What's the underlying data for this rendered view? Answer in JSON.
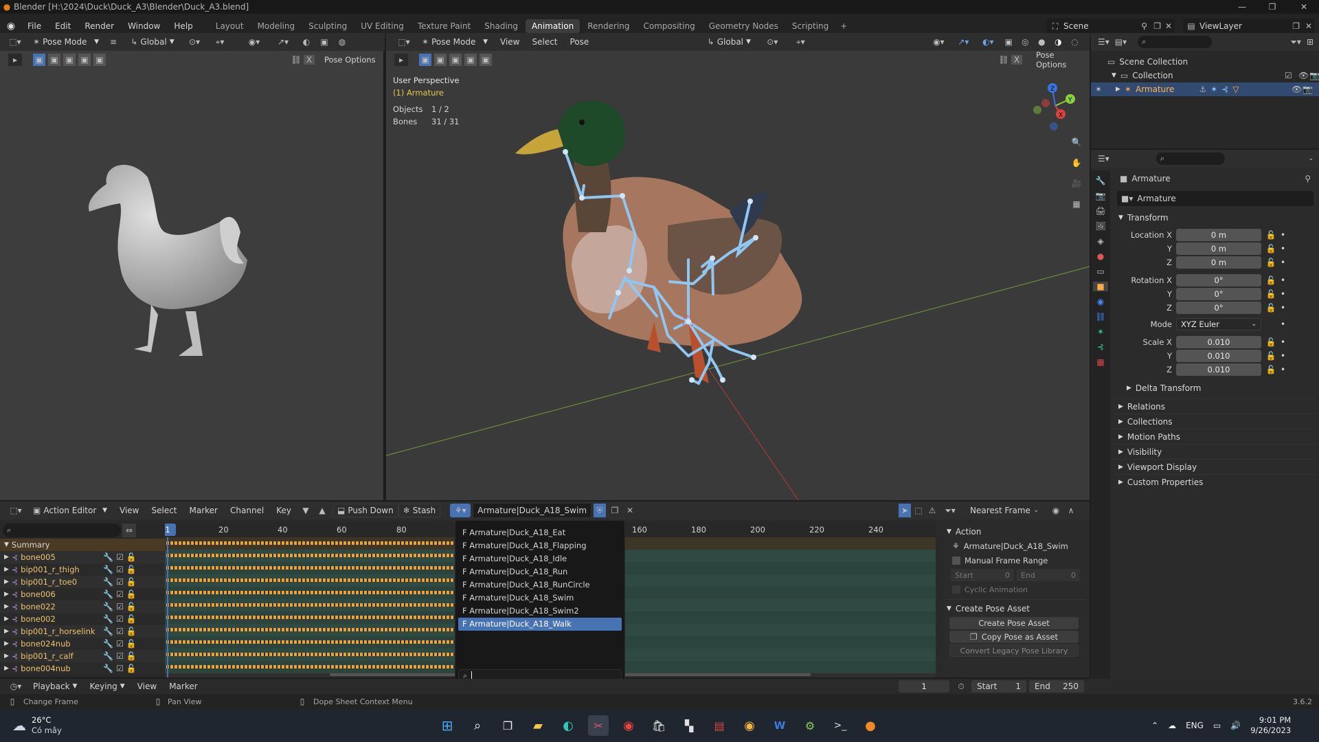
{
  "window": {
    "title": "Blender [H:\\2024\\Duck\\Duck_A3\\Blender\\Duck_A3.blend]"
  },
  "menu": [
    "File",
    "Edit",
    "Render",
    "Window",
    "Help"
  ],
  "workspaces": [
    "Layout",
    "Modeling",
    "Sculpting",
    "UV Editing",
    "Texture Paint",
    "Shading",
    "Animation",
    "Rendering",
    "Compositing",
    "Geometry Nodes",
    "Scripting",
    "+"
  ],
  "active_workspace": "Animation",
  "scene": {
    "name": "Scene",
    "view_layer": "ViewLayer"
  },
  "left_view": {
    "mode": "Pose Mode",
    "orientation": "Global",
    "options": "Pose Options"
  },
  "main_view": {
    "mode": "Pose Mode",
    "menu": [
      "View",
      "Select",
      "Pose"
    ],
    "orientation": "Global",
    "options": "Pose Options",
    "overlay_title": "User Perspective",
    "overlay_object": "(1) Armature",
    "objects_label": "Objects",
    "objects_value": "1 / 2",
    "bones_label": "Bones",
    "bones_value": "31 / 31"
  },
  "outliner": {
    "scene_collection": "Scene Collection",
    "collection": "Collection",
    "armature": "Armature"
  },
  "properties": {
    "object_name": "Armature",
    "datablock": "Armature",
    "transform_label": "Transform",
    "location": {
      "label": "Location X",
      "x": "0 m",
      "y": "0 m",
      "z": "0 m"
    },
    "rotation": {
      "label": "Rotation X",
      "x": "0°",
      "y": "0°",
      "z": "0°"
    },
    "mode_label": "Mode",
    "mode_value": "XYZ Euler",
    "scale": {
      "label": "Scale X",
      "x": "0.010",
      "y": "0.010",
      "z": "0.010"
    },
    "y_label": "Y",
    "z_label": "Z",
    "delta": "Delta Transform",
    "panels": [
      "Relations",
      "Collections",
      "Motion Paths",
      "Visibility",
      "Viewport Display",
      "Custom Properties"
    ]
  },
  "action_editor": {
    "editor": "Action Editor",
    "menu": [
      "View",
      "Select",
      "Marker",
      "Channel",
      "Key"
    ],
    "push_down": "Push Down",
    "stash": "Stash",
    "action": "Armature|Duck_A18_Swim",
    "snap": "Nearest Frame",
    "current_frame": "1",
    "ticks": [
      "20",
      "40",
      "60",
      "80",
      "160",
      "180",
      "200",
      "220",
      "240"
    ],
    "summary": "Summary",
    "channels": [
      "bone005",
      "bip001_r_thigh",
      "bip001_r_toe0",
      "bone006",
      "bone022",
      "bone002",
      "bip001_r_horselink",
      "bone024nub",
      "bip001_r_calf",
      "bone004nub"
    ]
  },
  "action_dropdown": {
    "items": [
      "F Armature|Duck_A18_Eat",
      "F Armature|Duck_A18_Flapping",
      "F Armature|Duck_A18_Idle",
      "F Armature|Duck_A18_Run",
      "F Armature|Duck_A18_RunCircle",
      "F Armature|Duck_A18_Swim",
      "F Armature|Duck_A18_Swim2",
      "F Armature|Duck_A18_Walk"
    ],
    "selected": 7
  },
  "action_panel": {
    "title": "Action",
    "name": "Armature|Duck_A18_Swim",
    "manual_range": "Manual Frame Range",
    "start_label": "Start",
    "start_value": "0",
    "end_label": "End",
    "end_value": "0",
    "cyclic": "Cyclic Animation",
    "pose_title": "Create Pose Asset",
    "create_btn": "Create Pose Asset",
    "copy_btn": "Copy Pose as Asset",
    "convert_btn": "Convert Legacy Pose Library"
  },
  "timeline": {
    "menu": [
      "Playback",
      "Keying",
      "View",
      "Marker"
    ],
    "frame": "1",
    "start_label": "Start",
    "start": "1",
    "end_label": "End",
    "end": "250"
  },
  "status": {
    "change_frame": "Change Frame",
    "pan_view": "Pan View",
    "context_menu": "Dope Sheet Context Menu",
    "version": "3.6.2"
  },
  "taskbar": {
    "temp": "26°C",
    "weather": "Có mây",
    "lang": "ENG",
    "time": "9:01 PM",
    "date": "9/26/2023"
  }
}
